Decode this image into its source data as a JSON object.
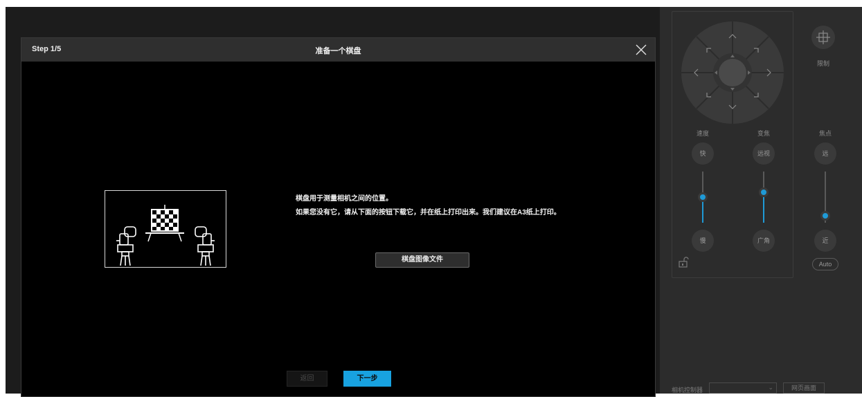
{
  "dialog": {
    "step": "Step 1/5",
    "title": "准备一个棋盘",
    "description": [
      "棋盘用于测量相机之间的位置。",
      "如果您没有它，请从下面的按钮下载它，并在纸上打印出来。我们建议在A3纸上打印。"
    ],
    "download_label": "棋盘图像文件",
    "back_label": "返回",
    "next_label": "下一步"
  },
  "panel": {
    "restrict_label": "限制",
    "speed": {
      "label": "速度",
      "top": "快",
      "bottom": "慢"
    },
    "zoom": {
      "label": "变焦",
      "top": "远视",
      "bottom": "广角"
    },
    "focus": {
      "label": "焦点",
      "top": "远",
      "bottom": "近",
      "auto": "Auto"
    },
    "camera_controller_label": "相机控制器",
    "web_label": "网页画面"
  },
  "colors": {
    "accent": "#18a2e0",
    "background": "#000000",
    "header": "#2f2f2f"
  }
}
